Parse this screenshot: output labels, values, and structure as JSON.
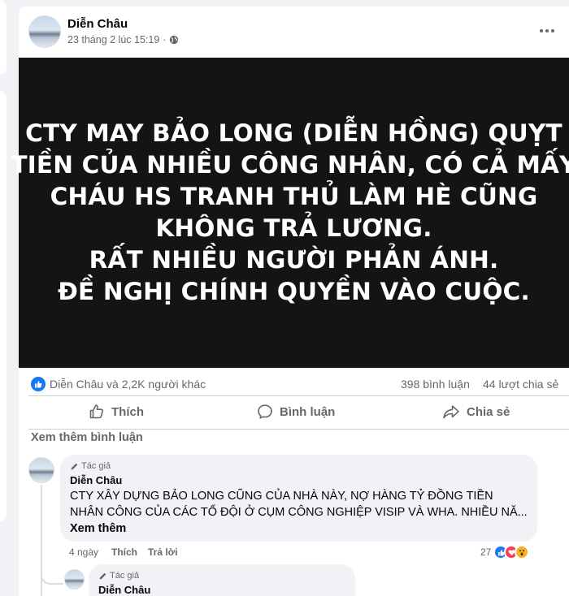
{
  "post": {
    "author": "Diễn Châu",
    "timestamp": "23 tháng 2 lúc 15:19",
    "image_text": [
      "CTY MAY BẢO LONG (DIỄN HỒNG) QUỴT",
      "TIỀN CỦA NHIỀU CÔNG NHÂN, CÓ CẢ MẤY",
      "CHÁU HS TRANH THỦ LÀM HÈ CŨNG",
      "KHÔNG TRẢ LƯƠNG.",
      "RẤT NHIỀU NGƯỜI PHẢN ÁNH.",
      "ĐỀ NGHỊ CHÍNH QUYỀN VÀO CUỘC."
    ],
    "reactors": "Diễn Châu và 2,2K người khác",
    "comments_count": "398 bình luận",
    "shares_count": "44 lượt chia sẻ"
  },
  "actions": {
    "like": "Thích",
    "comment": "Bình luận",
    "share": "Chia sẻ"
  },
  "see_more_comments": "Xem thêm bình luận",
  "comment": {
    "badge": "Tác giả",
    "author": "Diễn Châu",
    "text": "CTY XÂY DỰNG BẢO LONG CŨNG CỦA NHÀ NÀY, NỢ HÀNG TỶ ĐỒNG TIỀN NHÂN CÔNG CỦA CÁC TỔ ĐỘI Ở CỤM CÔNG NGHIỆP VISIP VÀ WHA. NHIỀU NĂ...",
    "see_more": "Xem thêm",
    "time_ago": "4 ngày",
    "like_label": "Thích",
    "reply_label": "Trả lời",
    "reaction_count": "27"
  },
  "reply": {
    "badge": "Tác giả",
    "author": "Diễn Châu"
  },
  "colors": {
    "accent": "#1877f2",
    "love": "#f33e58",
    "wow": "#f7b125",
    "secondary_text": "#65676b"
  }
}
